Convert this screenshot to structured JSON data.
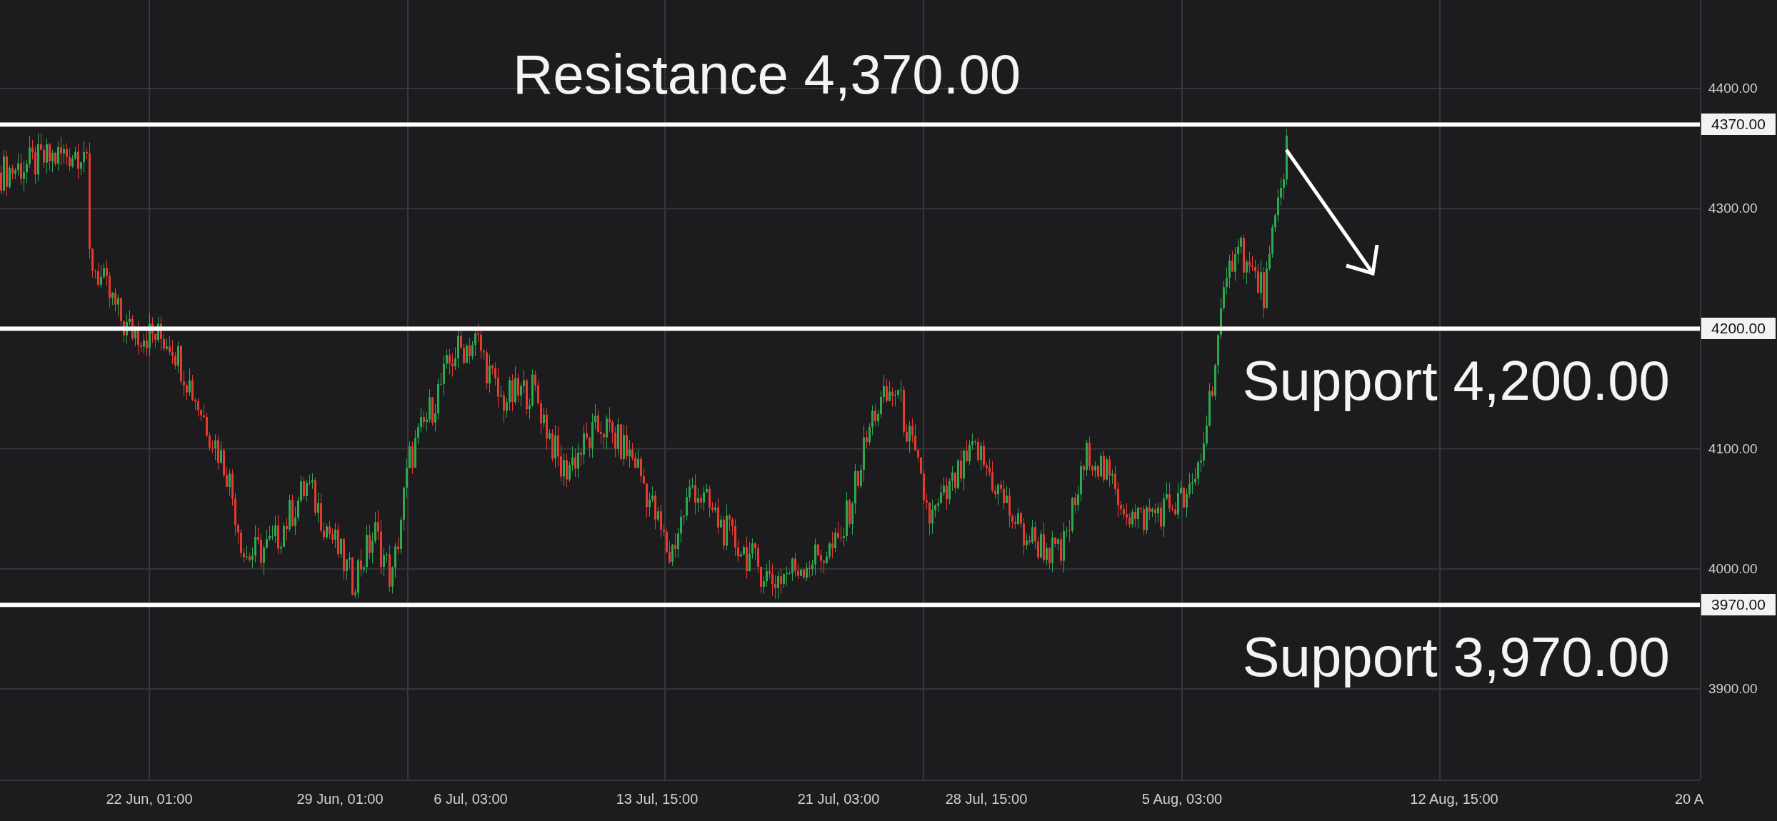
{
  "chart": {
    "price_axis": [
      "4400.00",
      "4300.00",
      "4100.00",
      "4000.00",
      "3900.00"
    ],
    "time_axis": [
      "22 Jun, 01:00",
      "29 Jun, 01:00",
      "6 Jul, 03:00",
      "13 Jul, 15:00",
      "21 Jul, 03:00",
      "28 Jul, 15:00",
      "5 Aug, 03:00",
      "12 Aug, 15:00",
      "20 A"
    ],
    "levels": [
      {
        "kind": "resistance",
        "label": "Resistance 4,370.00",
        "price_tag": "4370.00"
      },
      {
        "kind": "support",
        "label": "Support 4,200.00",
        "price_tag": "4200.00"
      },
      {
        "kind": "support",
        "label": "Support 3,970.00",
        "price_tag": "3970.00"
      }
    ]
  }
}
